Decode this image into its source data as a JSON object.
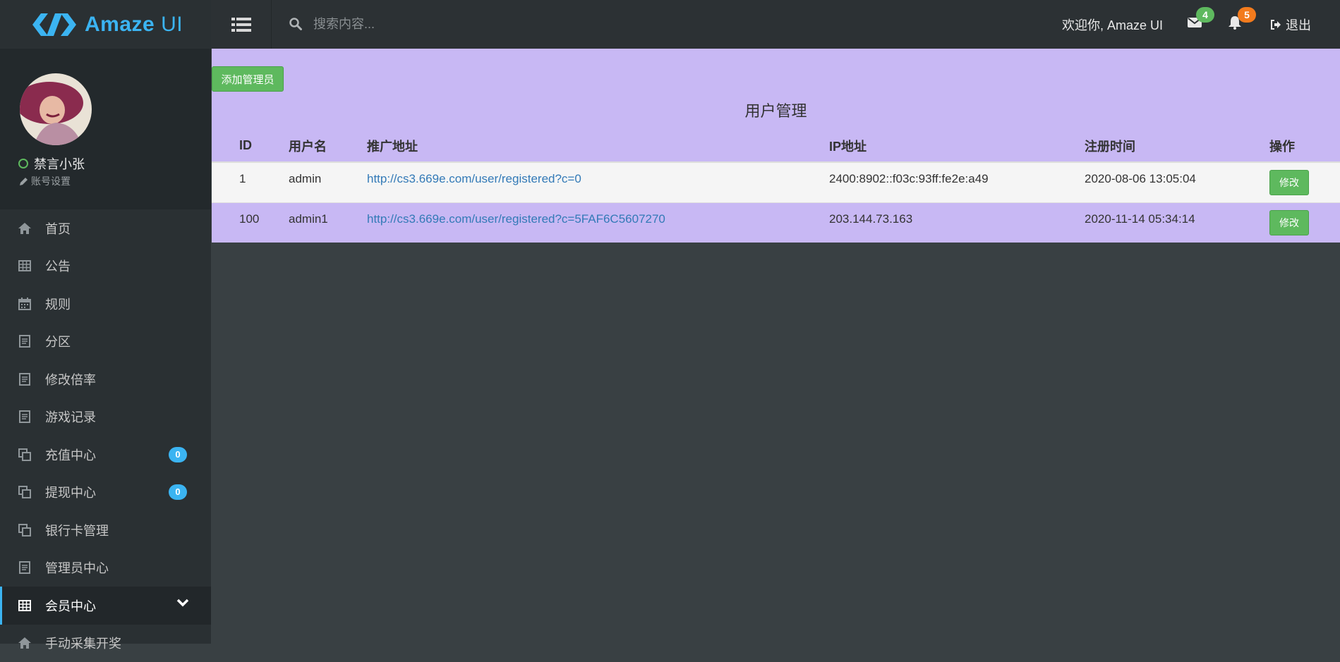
{
  "header": {
    "logo_text": "Amaze",
    "logo_text_ui": "UI",
    "search_placeholder": "搜索内容...",
    "welcome": "欢迎你, Amaze UI",
    "mail_badge": "4",
    "bell_badge": "5",
    "logout": "退出"
  },
  "sidebar": {
    "user_name": "禁言小张",
    "account_settings": "账号设置",
    "items": [
      {
        "label": "首页",
        "icon": "home-icon"
      },
      {
        "label": "公告",
        "icon": "table-icon"
      },
      {
        "label": "规则",
        "icon": "calendar-icon"
      },
      {
        "label": "分区",
        "icon": "form-icon"
      },
      {
        "label": "修改倍率",
        "icon": "form-icon"
      },
      {
        "label": "游戏记录",
        "icon": "form-icon"
      },
      {
        "label": "充值中心",
        "icon": "copy-icon",
        "badge": "0"
      },
      {
        "label": "提现中心",
        "icon": "copy-icon",
        "badge": "0"
      },
      {
        "label": "银行卡管理",
        "icon": "copy-icon"
      },
      {
        "label": "管理员中心",
        "icon": "form-icon"
      },
      {
        "label": "会员中心",
        "icon": "table-icon"
      },
      {
        "label": "手动采集开奖",
        "icon": "home-icon"
      }
    ]
  },
  "main": {
    "add_button": "添加管理员",
    "title": "用户管理",
    "columns": [
      "ID",
      "用户名",
      "推广地址",
      "IP地址",
      "注册时间",
      "操作"
    ],
    "rows": [
      {
        "id": "1",
        "username": "admin",
        "url": "http://cs3.669e.com/user/registered?c=0",
        "ip": "2400:8902::f03c:93ff:fe2e:a49",
        "time": "2020-08-06 13:05:04",
        "action": "修改"
      },
      {
        "id": "100",
        "username": "admin1",
        "url": "http://cs3.669e.com/user/registered?c=5FAF6C5607270",
        "ip": "203.144.73.163",
        "time": "2020-11-14 05:34:14",
        "action": "修改"
      }
    ]
  },
  "colors": {
    "accent": "#3bb4f2",
    "success": "#5eb95e",
    "warning": "#f37b1d",
    "panel": "#c8b8f4"
  }
}
